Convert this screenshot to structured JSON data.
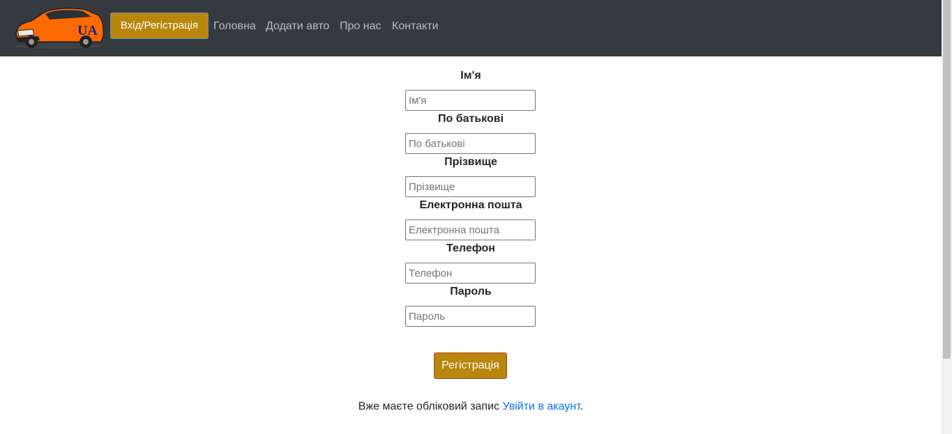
{
  "navbar": {
    "logo_text": "UA",
    "login_button": "Вхід/Регістрація",
    "links": [
      "Головна",
      "Додати авто",
      "Про нас",
      "Контакти"
    ]
  },
  "form": {
    "fields": [
      {
        "label": "Ім'я",
        "placeholder": "Ім'я"
      },
      {
        "label": "По батькові",
        "placeholder": "По батькові"
      },
      {
        "label": "Прізвище",
        "placeholder": "Прізвище"
      },
      {
        "label": "Електронна пошта",
        "placeholder": "Електронна пошта"
      },
      {
        "label": "Телефон",
        "placeholder": "Телефон"
      },
      {
        "label": "Пароль",
        "placeholder": "Пароль"
      }
    ],
    "submit_label": "Регістрація"
  },
  "footer": {
    "text": "Вже маєте обліковий запис ",
    "link": "Увійти в акаунт",
    "end": "."
  },
  "colors": {
    "navbar": "#343a40",
    "accent": "#b8860b",
    "link": "#0d6efd"
  }
}
